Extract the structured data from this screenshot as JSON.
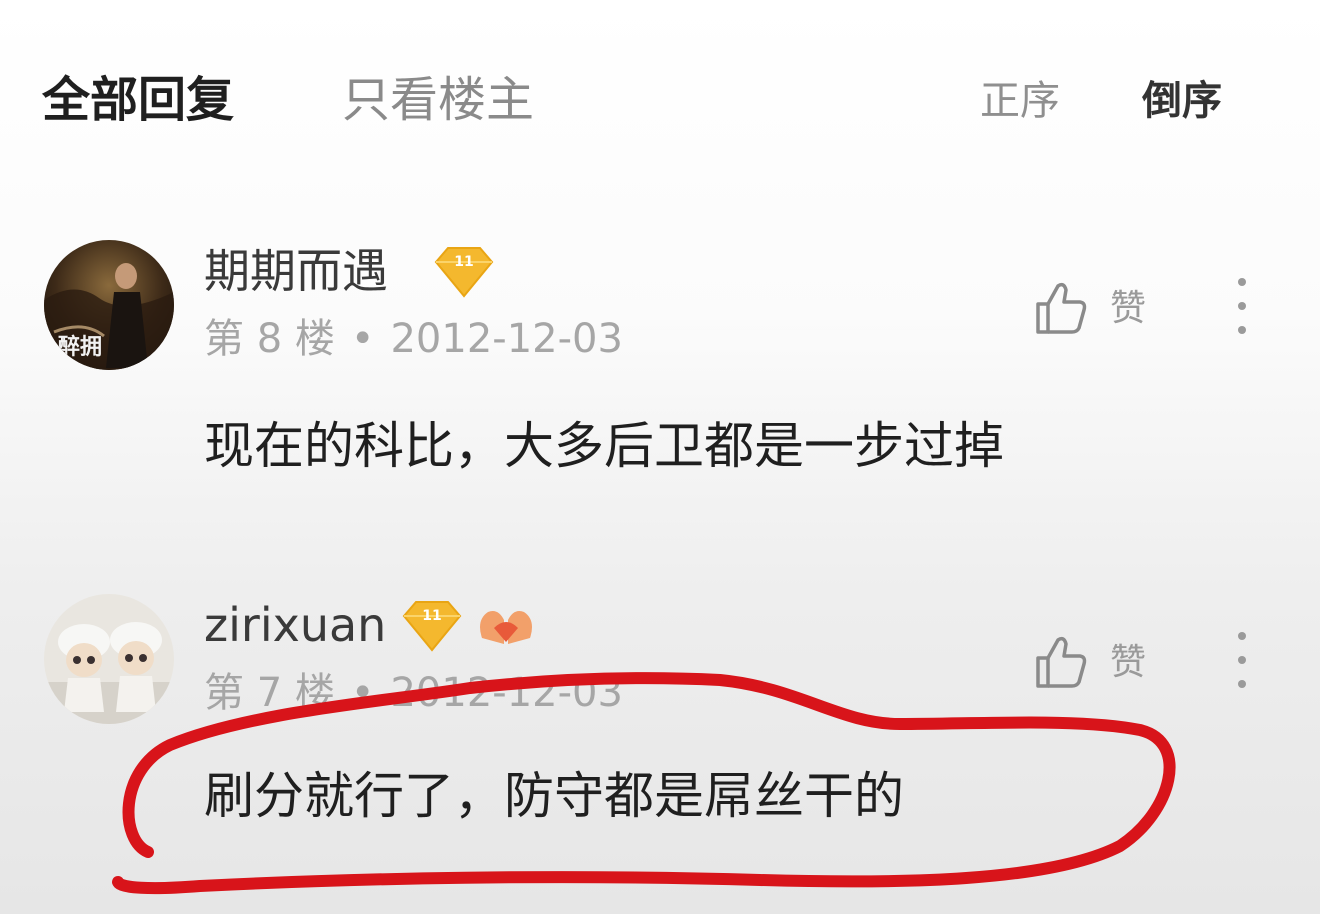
{
  "tabs": {
    "all_replies": "全部回复",
    "op_only": "只看楼主"
  },
  "sort": {
    "ascending": "正序",
    "descending": "倒序",
    "selected": "倒序"
  },
  "comments": [
    {
      "username": "期期而遇",
      "floor": "第 8 楼",
      "date": "2012-12-03",
      "like_label": "赞",
      "text": "现在的科比，大多后卫都是一步过掉",
      "avatar_caption": "醉拥",
      "badge_level": "11",
      "badges": [
        "level-badge"
      ]
    },
    {
      "username": "zirixuan",
      "floor": "第 7 楼",
      "date": "2012-12-03",
      "like_label": "赞",
      "text": "刷分就行了，防守都是屌丝干的",
      "badge_level": "11",
      "badges": [
        "level-badge",
        "heart-hands-badge"
      ],
      "highlighted": true
    }
  ],
  "colors": {
    "annotation": "#d8141a",
    "badge_gold": "#f4b82e",
    "meta_gray": "#a6a6a6"
  }
}
